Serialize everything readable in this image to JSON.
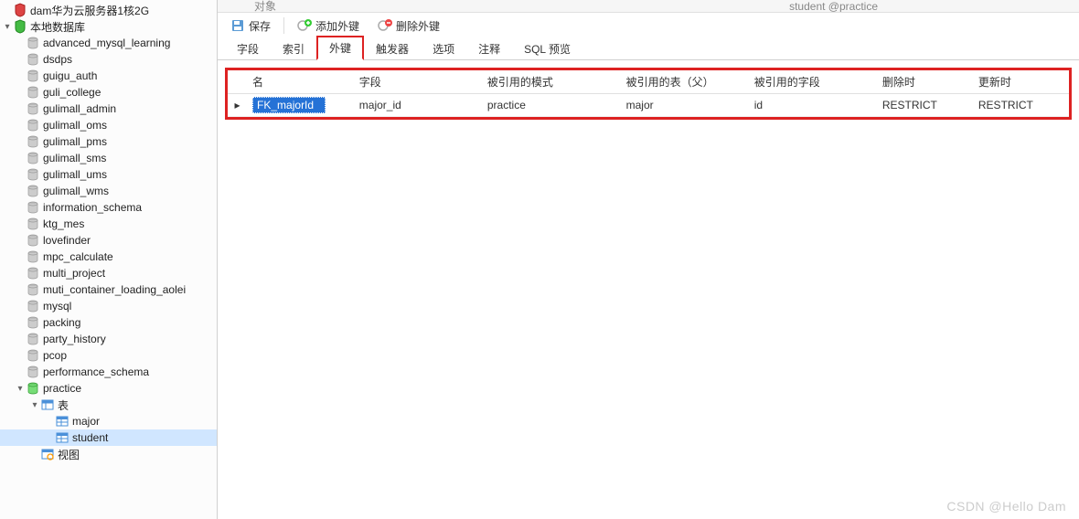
{
  "sidebar": {
    "nodes": [
      {
        "level": 0,
        "expander": "",
        "iconType": "server-red",
        "label": "dam华为云服务器1核2G"
      },
      {
        "level": 0,
        "expander": "▾",
        "iconType": "server-green",
        "label": "本地数据库"
      },
      {
        "level": 1,
        "expander": "",
        "iconType": "db",
        "label": "advanced_mysql_learning"
      },
      {
        "level": 1,
        "expander": "",
        "iconType": "db",
        "label": "dsdps"
      },
      {
        "level": 1,
        "expander": "",
        "iconType": "db",
        "label": "guigu_auth"
      },
      {
        "level": 1,
        "expander": "",
        "iconType": "db",
        "label": "guli_college"
      },
      {
        "level": 1,
        "expander": "",
        "iconType": "db",
        "label": "gulimall_admin"
      },
      {
        "level": 1,
        "expander": "",
        "iconType": "db",
        "label": "gulimall_oms"
      },
      {
        "level": 1,
        "expander": "",
        "iconType": "db",
        "label": "gulimall_pms"
      },
      {
        "level": 1,
        "expander": "",
        "iconType": "db",
        "label": "gulimall_sms"
      },
      {
        "level": 1,
        "expander": "",
        "iconType": "db",
        "label": "gulimall_ums"
      },
      {
        "level": 1,
        "expander": "",
        "iconType": "db",
        "label": "gulimall_wms"
      },
      {
        "level": 1,
        "expander": "",
        "iconType": "db",
        "label": "information_schema"
      },
      {
        "level": 1,
        "expander": "",
        "iconType": "db",
        "label": "ktg_mes"
      },
      {
        "level": 1,
        "expander": "",
        "iconType": "db",
        "label": "lovefinder"
      },
      {
        "level": 1,
        "expander": "",
        "iconType": "db",
        "label": "mpc_calculate"
      },
      {
        "level": 1,
        "expander": "",
        "iconType": "db",
        "label": "multi_project"
      },
      {
        "level": 1,
        "expander": "",
        "iconType": "db",
        "label": "muti_container_loading_aolei"
      },
      {
        "level": 1,
        "expander": "",
        "iconType": "db",
        "label": "mysql"
      },
      {
        "level": 1,
        "expander": "",
        "iconType": "db",
        "label": "packing"
      },
      {
        "level": 1,
        "expander": "",
        "iconType": "db",
        "label": "party_history"
      },
      {
        "level": 1,
        "expander": "",
        "iconType": "db",
        "label": "pcop"
      },
      {
        "level": 1,
        "expander": "",
        "iconType": "db",
        "label": "performance_schema"
      },
      {
        "level": 1,
        "expander": "▾",
        "iconType": "db-active",
        "label": "practice"
      },
      {
        "level": 2,
        "expander": "▾",
        "iconType": "tables-folder",
        "label": "表"
      },
      {
        "level": 3,
        "expander": "",
        "iconType": "table",
        "label": "major"
      },
      {
        "level": 3,
        "expander": "",
        "iconType": "table",
        "label": "student",
        "selected": true
      },
      {
        "level": 2,
        "expander": "",
        "iconType": "view",
        "label": "视图"
      }
    ]
  },
  "topbar": {
    "fragment1": "对象",
    "fragment2": "student @practice"
  },
  "toolbar": {
    "save": "保存",
    "addFk": "添加外键",
    "delFk": "删除外键"
  },
  "tabs": [
    {
      "label": "字段",
      "active": false
    },
    {
      "label": "索引",
      "active": false
    },
    {
      "label": "外键",
      "active": true
    },
    {
      "label": "触发器",
      "active": false
    },
    {
      "label": "选项",
      "active": false
    },
    {
      "label": "注释",
      "active": false
    },
    {
      "label": "SQL 预览",
      "active": false
    }
  ],
  "fkTable": {
    "headers": {
      "name": "名",
      "field": "字段",
      "refSchema": "被引用的模式",
      "refTableParent": "被引用的表（父）",
      "refField": "被引用的字段",
      "onDelete": "删除时",
      "onUpdate": "更新时"
    },
    "rows": [
      {
        "name": "FK_majorId",
        "field": "major_id",
        "refSchema": "practice",
        "refTable": "major",
        "refField": "id",
        "onDelete": "RESTRICT",
        "onUpdate": "RESTRICT"
      }
    ]
  },
  "watermark": "CSDN @Hello Dam"
}
